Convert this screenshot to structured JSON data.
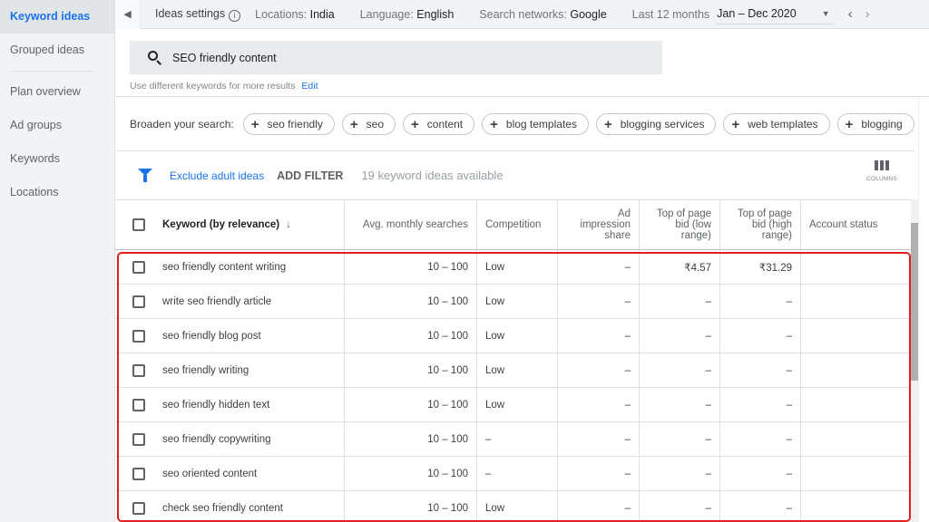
{
  "sidebar": {
    "items": [
      {
        "label": "Keyword ideas",
        "active": true
      },
      {
        "label": "Grouped ideas"
      },
      {
        "label": "Plan overview"
      },
      {
        "label": "Ad groups"
      },
      {
        "label": "Keywords"
      },
      {
        "label": "Locations"
      }
    ]
  },
  "topbar": {
    "ideas_settings": "Ideas settings",
    "locations_label": "Locations:",
    "locations_value": "India",
    "language_label": "Language:",
    "language_value": "English",
    "networks_label": "Search networks:",
    "networks_value": "Google",
    "period_label": "Last 12 months",
    "date_range": "Jan – Dec 2020"
  },
  "search": {
    "value": "SEO friendly content",
    "hint": "Use different keywords for more results",
    "edit_label": "Edit"
  },
  "broaden": {
    "label": "Broaden your search:",
    "chips": [
      "seo friendly",
      "seo",
      "content",
      "blog templates",
      "blogging services",
      "web templates",
      "blogging"
    ]
  },
  "filterbar": {
    "exclude_label": "Exclude adult ideas",
    "add_filter_label": "ADD FILTER",
    "ideas_count": "19 keyword ideas available",
    "columns_label": "COLUMNS"
  },
  "table": {
    "headers": {
      "keyword": "Keyword (by relevance)",
      "avg_searches": "Avg. monthly searches",
      "competition": "Competition",
      "ad_impression": "Ad impression share",
      "bid_low": "Top of page bid (low range)",
      "bid_high": "Top of page bid (high range)",
      "account_status": "Account status"
    },
    "rows": [
      {
        "keyword": "seo friendly content writing",
        "avg": "10 – 100",
        "competition": "Low",
        "ad_share": "–",
        "bid_low": "₹4.57",
        "bid_high": "₹31.29",
        "status": ""
      },
      {
        "keyword": "write seo friendly article",
        "avg": "10 – 100",
        "competition": "Low",
        "ad_share": "–",
        "bid_low": "–",
        "bid_high": "–",
        "status": ""
      },
      {
        "keyword": "seo friendly blog post",
        "avg": "10 – 100",
        "competition": "Low",
        "ad_share": "–",
        "bid_low": "–",
        "bid_high": "–",
        "status": ""
      },
      {
        "keyword": "seo friendly writing",
        "avg": "10 – 100",
        "competition": "Low",
        "ad_share": "–",
        "bid_low": "–",
        "bid_high": "–",
        "status": ""
      },
      {
        "keyword": "seo friendly hidden text",
        "avg": "10 – 100",
        "competition": "Low",
        "ad_share": "–",
        "bid_low": "–",
        "bid_high": "–",
        "status": ""
      },
      {
        "keyword": "seo friendly copywriting",
        "avg": "10 – 100",
        "competition": "–",
        "ad_share": "–",
        "bid_low": "–",
        "bid_high": "–",
        "status": ""
      },
      {
        "keyword": "seo oriented content",
        "avg": "10 – 100",
        "competition": "–",
        "ad_share": "–",
        "bid_low": "–",
        "bid_high": "–",
        "status": ""
      },
      {
        "keyword": "check seo friendly content",
        "avg": "10 – 100",
        "competition": "Low",
        "ad_share": "–",
        "bid_low": "–",
        "bid_high": "–",
        "status": ""
      }
    ]
  },
  "colors": {
    "accent": "#1a73e8",
    "highlight_border": "#e02020"
  }
}
